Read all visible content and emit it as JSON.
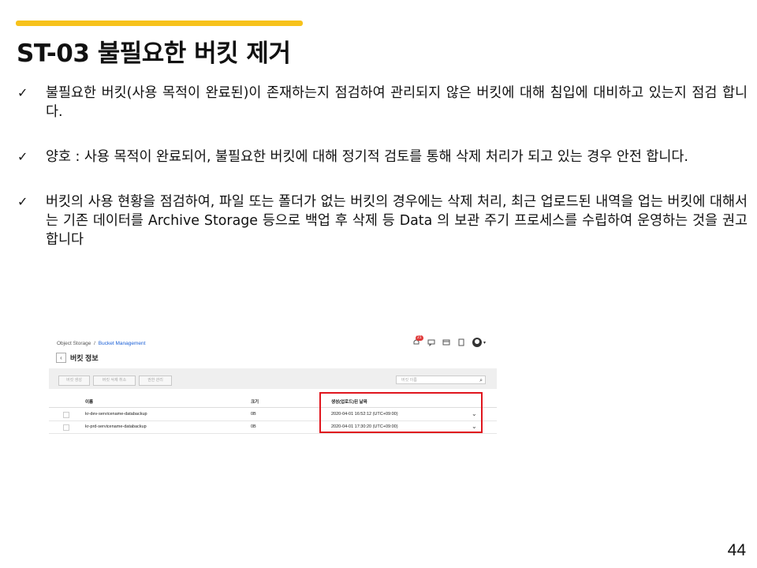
{
  "slide": {
    "title": "ST-03 불필요한 버킷 제거",
    "check_mark": "✓",
    "bullets": [
      "불필요한 버킷(사용 목적이 완료된)이 존재하는지 점검하여 관리되지 않은 버킷에 대해 침입에 대비하고 있는지 점검 합니다.",
      "양호 : 사용 목적이 완료되어, 불필요한 버킷에 대해 정기적 검토를 통해 삭제 처리가 되고 있는 경우 안전 합니다.",
      "버킷의 사용 현황을 점검하여, 파일 또는 폴더가 없는 버킷의 경우에는 삭제 처리, 최근 업로드된 내역을 업는 버킷에 대해서는 기존 데이터를 Archive Storage 등으로 백업 후 삭제 등 Data 의 보관 주기 프로세스를 수립하여 운영하는 것을 권고 합니다"
    ],
    "page_number": "44",
    "accent_color": "#f7c21b"
  },
  "console": {
    "breadcrumb": [
      "Object Storage",
      "Bucket Management"
    ],
    "breadcrumb_sep": "/",
    "notification_count": "21",
    "page_title": "버킷 정보",
    "back_glyph": "‹",
    "toolbar_buttons": [
      "버킷 생성",
      "버킷 삭제 취소",
      "권한 관리"
    ],
    "search_placeholder": "버킷 이름",
    "columns": [
      "이름",
      "크기",
      "생성(업로드)된 날짜"
    ],
    "rows": [
      {
        "name": "kr-dev-servicename-databackup",
        "size": "0B",
        "created": "2020-04-01 16:52:12 (UTC+09:00)"
      },
      {
        "name": "kr-prd-servicename-databackup",
        "size": "0B",
        "created": "2020-04-01 17:30:20 (UTC+09:00)"
      }
    ],
    "highlight_color": "#e0161e",
    "icons": [
      "bell-icon",
      "chat-icon",
      "mail-icon",
      "document-icon",
      "user-avatar-icon",
      "search-icon",
      "chevron-down-icon"
    ]
  }
}
